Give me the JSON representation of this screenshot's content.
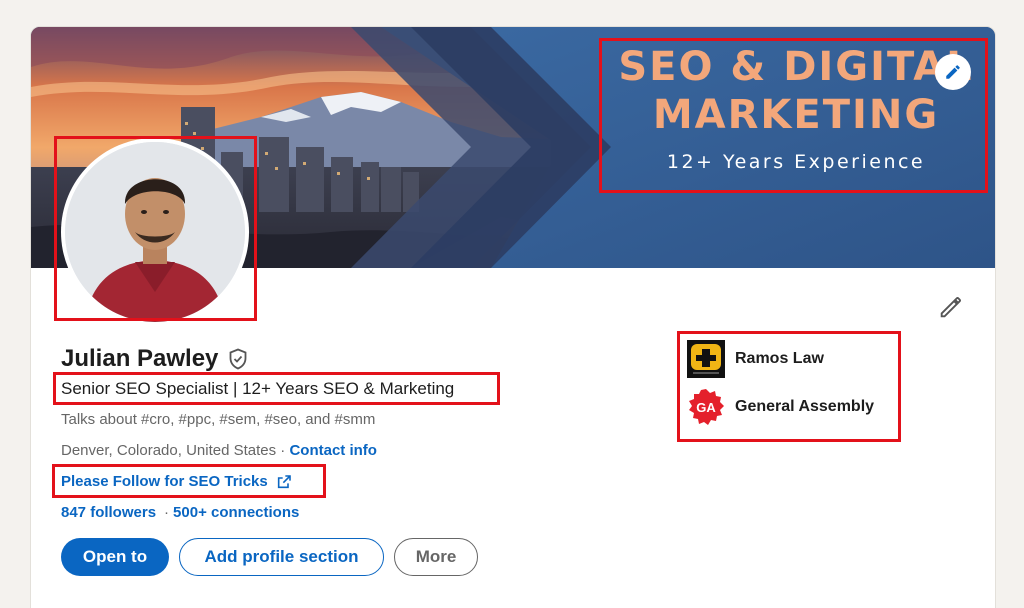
{
  "banner": {
    "title_line1": "SEO & DIGITAL",
    "title_line2": "MARKETING",
    "subtitle": "12+ Years Experience"
  },
  "profile": {
    "name": "Julian Pawley",
    "headline": "Senior SEO Specialist | 12+ Years SEO & Marketing",
    "talks_about": "Talks about #cro, #ppc, #sem, #seo, and #smm",
    "location": "Denver, Colorado, United States",
    "location_separator": " · ",
    "contact_info": "Contact info",
    "custom_link": "Please Follow for SEO Tricks",
    "followers": "847 followers",
    "stats_separator": "·",
    "connections": "500+ connections"
  },
  "actions": {
    "open_to": "Open to",
    "add_section": "Add profile section",
    "more": "More"
  },
  "organizations": [
    {
      "name": "Ramos Law"
    },
    {
      "name": "General Assembly",
      "logo_text": "GA"
    }
  ],
  "colors": {
    "link_blue": "#0a66c2",
    "banner_blue": "#355a8c",
    "title_orange": "#f3a77b",
    "highlight_red": "#e3111a"
  },
  "icons": {
    "banner_edit": "pencil-icon",
    "intro_edit": "pencil-icon",
    "verified": "verified-shield-icon",
    "external_link": "external-link-icon"
  }
}
